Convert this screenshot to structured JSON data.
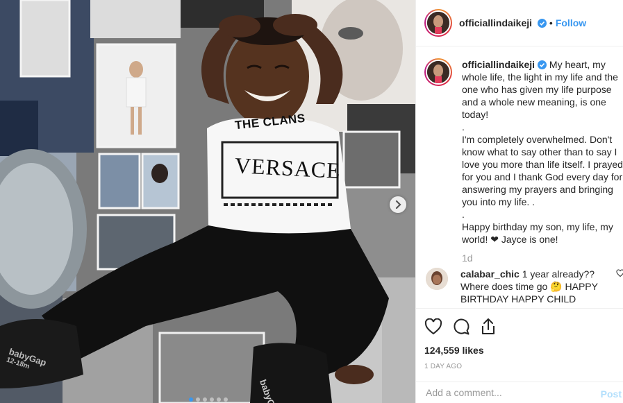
{
  "post": {
    "username": "officiallindaikeji",
    "follow_label": "Follow",
    "separator": "•",
    "caption": "My heart, my whole life, the light in my life and the one who has given my life purpose and a whole new meaning, is one today!\n.\nI'm completely overwhelmed. Don't know what to say other than to say I love you more than life itself. I prayed for you and I thank God every day for answering my prayers and bringing you into my life. .\n.\nHappy birthday my son, my life, my world! ❤ Jayce is one!",
    "time_ago": "1d",
    "likes": "124,559 likes",
    "date": "1 DAY AGO"
  },
  "shirt": {
    "line1": "THE CLANS",
    "line2": "VERSACE"
  },
  "socks": {
    "left": "babyGap",
    "left_size": "12-18m",
    "right": "babyGap"
  },
  "comment": {
    "username": "calabar_chic",
    "text": "1 year already?? Where does time go 🤔 HAPPY BIRTHDAY HAPPY CHILD"
  },
  "add_comment": {
    "placeholder": "Add a comment...",
    "post_label": "Post"
  },
  "carousel": {
    "current_index": 1,
    "total": 6
  },
  "icons": [
    "verified-badge-icon",
    "heart-icon",
    "comment-icon",
    "share-icon",
    "chevron-right-icon"
  ],
  "colors": {
    "link": "#3897f0",
    "muted": "#999999",
    "text": "#262626"
  }
}
